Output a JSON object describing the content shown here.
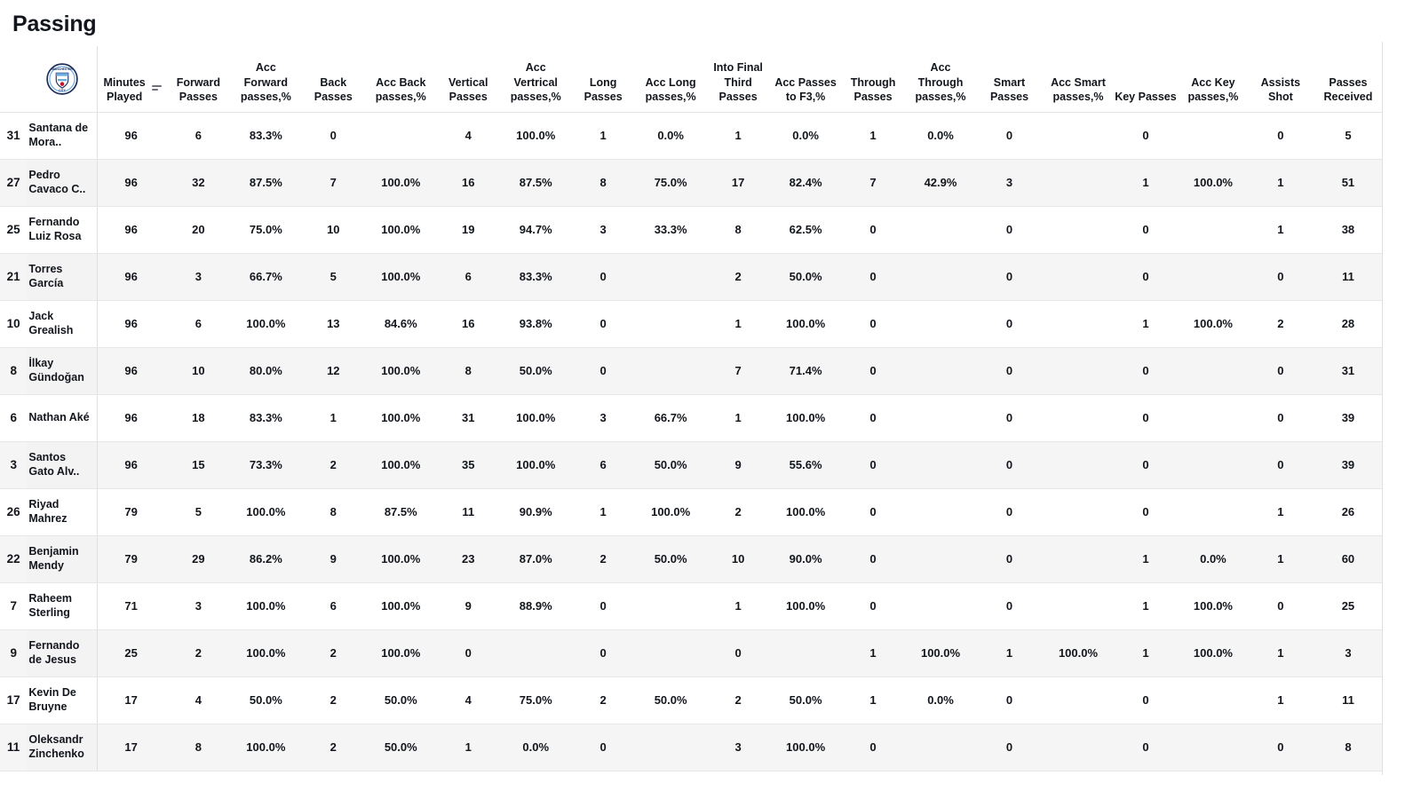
{
  "page": {
    "title": "Passing",
    "team_logo": "manchester-city-crest-icon",
    "sort_icon": "sort-descending-icon",
    "sorted_column": "Minutes Played"
  },
  "table": {
    "columns": [
      "Minutes Played",
      "Forward Passes",
      "Acc Forward passes,%",
      "Back Passes",
      "Acc Back passes,%",
      "Vertical Passes",
      "Acc Vertrical passes,%",
      "Long Passes",
      "Acc Long passes,%",
      "Into Final Third Passes",
      "Acc Passes to F3,%",
      "Through Passes",
      "Acc Through passes,%",
      "Smart Passes",
      "Acc Smart passes,%",
      "Key Passes",
      "Acc Key passes,%",
      "Assists Shot",
      "Passes Received"
    ],
    "rows": [
      {
        "number": "31",
        "name": "Santana de Mora..",
        "values": [
          "96",
          "6",
          "83.3%",
          "0",
          "",
          "4",
          "100.0%",
          "1",
          "0.0%",
          "1",
          "0.0%",
          "1",
          "0.0%",
          "0",
          "",
          "0",
          "",
          "0",
          "5"
        ]
      },
      {
        "number": "27",
        "name": "Pedro Cavaco C..",
        "values": [
          "96",
          "32",
          "87.5%",
          "7",
          "100.0%",
          "16",
          "87.5%",
          "8",
          "75.0%",
          "17",
          "82.4%",
          "7",
          "42.9%",
          "3",
          "",
          "1",
          "100.0%",
          "1",
          "51"
        ]
      },
      {
        "number": "25",
        "name": "Fernando Luiz Rosa",
        "values": [
          "96",
          "20",
          "75.0%",
          "10",
          "100.0%",
          "19",
          "94.7%",
          "3",
          "33.3%",
          "8",
          "62.5%",
          "0",
          "",
          "0",
          "",
          "0",
          "",
          "1",
          "38"
        ]
      },
      {
        "number": "21",
        "name": "Torres García",
        "values": [
          "96",
          "3",
          "66.7%",
          "5",
          "100.0%",
          "6",
          "83.3%",
          "0",
          "",
          "2",
          "50.0%",
          "0",
          "",
          "0",
          "",
          "0",
          "",
          "0",
          "11"
        ]
      },
      {
        "number": "10",
        "name": "Jack Grealish",
        "values": [
          "96",
          "6",
          "100.0%",
          "13",
          "84.6%",
          "16",
          "93.8%",
          "0",
          "",
          "1",
          "100.0%",
          "0",
          "",
          "0",
          "",
          "1",
          "100.0%",
          "2",
          "28"
        ]
      },
      {
        "number": "8",
        "name": "İlkay Gündoğan",
        "values": [
          "96",
          "10",
          "80.0%",
          "12",
          "100.0%",
          "8",
          "50.0%",
          "0",
          "",
          "7",
          "71.4%",
          "0",
          "",
          "0",
          "",
          "0",
          "",
          "0",
          "31"
        ]
      },
      {
        "number": "6",
        "name": "Nathan Aké",
        "values": [
          "96",
          "18",
          "83.3%",
          "1",
          "100.0%",
          "31",
          "100.0%",
          "3",
          "66.7%",
          "1",
          "100.0%",
          "0",
          "",
          "0",
          "",
          "0",
          "",
          "0",
          "39"
        ]
      },
      {
        "number": "3",
        "name": "Santos Gato Alv..",
        "values": [
          "96",
          "15",
          "73.3%",
          "2",
          "100.0%",
          "35",
          "100.0%",
          "6",
          "50.0%",
          "9",
          "55.6%",
          "0",
          "",
          "0",
          "",
          "0",
          "",
          "0",
          "39"
        ]
      },
      {
        "number": "26",
        "name": "Riyad Mahrez",
        "values": [
          "79",
          "5",
          "100.0%",
          "8",
          "87.5%",
          "11",
          "90.9%",
          "1",
          "100.0%",
          "2",
          "100.0%",
          "0",
          "",
          "0",
          "",
          "0",
          "",
          "1",
          "26"
        ]
      },
      {
        "number": "22",
        "name": "Benjamin Mendy",
        "values": [
          "79",
          "29",
          "86.2%",
          "9",
          "100.0%",
          "23",
          "87.0%",
          "2",
          "50.0%",
          "10",
          "90.0%",
          "0",
          "",
          "0",
          "",
          "1",
          "0.0%",
          "1",
          "60"
        ]
      },
      {
        "number": "7",
        "name": "Raheem Sterling",
        "values": [
          "71",
          "3",
          "100.0%",
          "6",
          "100.0%",
          "9",
          "88.9%",
          "0",
          "",
          "1",
          "100.0%",
          "0",
          "",
          "0",
          "",
          "1",
          "100.0%",
          "0",
          "25"
        ]
      },
      {
        "number": "9",
        "name": "Fernando de Jesus",
        "values": [
          "25",
          "2",
          "100.0%",
          "2",
          "100.0%",
          "0",
          "",
          "0",
          "",
          "0",
          "",
          "1",
          "100.0%",
          "1",
          "100.0%",
          "1",
          "100.0%",
          "1",
          "3"
        ]
      },
      {
        "number": "17",
        "name": "Kevin De Bruyne",
        "values": [
          "17",
          "4",
          "50.0%",
          "2",
          "50.0%",
          "4",
          "75.0%",
          "2",
          "50.0%",
          "2",
          "50.0%",
          "1",
          "0.0%",
          "0",
          "",
          "0",
          "",
          "1",
          "11"
        ]
      },
      {
        "number": "11",
        "name": "Oleksandr Zinchenko",
        "values": [
          "17",
          "8",
          "100.0%",
          "2",
          "50.0%",
          "1",
          "0.0%",
          "0",
          "",
          "3",
          "100.0%",
          "0",
          "",
          "0",
          "",
          "0",
          "",
          "0",
          "8"
        ]
      }
    ]
  },
  "colors": {
    "text": "#12161c",
    "row_alt": "#f5f5f5",
    "border": "#e6e7e9",
    "crest_blue": "#6CABDD",
    "crest_navy": "#1C2C5B"
  }
}
